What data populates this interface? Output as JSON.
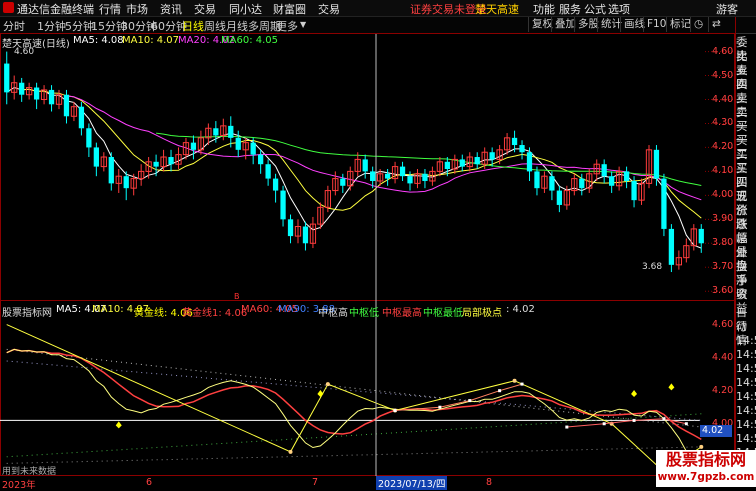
{
  "titlebar": {
    "app_name": "通达信金融终端",
    "menus": [
      "行情",
      "市场",
      "资讯",
      "交易",
      "同小达",
      "财富圈",
      "交易"
    ],
    "login_warning": "证券交易未登录",
    "stock_name": "楚天高速",
    "right_menus": [
      "功能",
      "服务",
      "公式",
      "选项",
      "游客"
    ]
  },
  "toolbar": {
    "periods": [
      "分时",
      "1分钟",
      "5分钟",
      "15分钟",
      "30分钟",
      "60分钟",
      "日线",
      "周线",
      "月线",
      "多周期",
      "更多"
    ],
    "active_period": "日线",
    "right_buttons": [
      "复权",
      "叠加",
      "多股",
      "统计",
      "画线",
      "F10",
      "标记"
    ]
  },
  "upper_legend": {
    "name": "楚天高速(日线)",
    "ma5": "MA5: 4.08",
    "ma10": "MA10: 4.07",
    "ma20": "MA20: 4.02",
    "ma60": "MA60: 4.05"
  },
  "upper_axis": [
    "4.60",
    "4.50",
    "4.40",
    "4.30",
    "4.20",
    "4.10",
    "4.00",
    "3.90",
    "3.80",
    "3.70",
    "3.60"
  ],
  "high_label": "4.60",
  "low_label": "3.68",
  "marker_b": "B",
  "lower_legend": {
    "name": "股票指标网",
    "ma5": "MA5: 4.07",
    "ma10": "MA10: 4.07",
    "gold": "黄金线: 4.06",
    "gold1": "黄金线1: 4.06",
    "ma60": "MA60: 4.05",
    "ma90": "MA90: 3.88",
    "zs_high": "中枢高",
    "zs_low": "中枢低",
    "zs_max": "中枢最高",
    "zs_min": "中枢最低",
    "local": "局部极点",
    "value": ": 4.02"
  },
  "lower_axis": [
    "4.60",
    "4.40",
    "4.20",
    "4.00",
    "3.80"
  ],
  "lower_tag": "4.02",
  "note": "用到未来数据",
  "date_axis": {
    "year": "2023年",
    "months": [
      "6",
      "7",
      "8"
    ],
    "cursor_date": "2023/07/13/四"
  },
  "right_panel_upper": [
    "委比",
    "卖五",
    "卖四",
    "卖三",
    "卖二",
    "卖一",
    "买一",
    "买二",
    "买三",
    "买四",
    "买五",
    "现价",
    "涨跌",
    "涨幅",
    "总量",
    "外盘",
    "换手",
    "净资",
    "收益"
  ],
  "right_panel_lower": [
    "自动",
    "行情",
    "14:5",
    "14:5",
    "14:5",
    "14:5",
    "14:5",
    "14:5",
    "14:5",
    "14:5",
    "14:5",
    "14:5"
  ],
  "watermark": {
    "cn": "股票指标网",
    "url": "www.7gpzb.com"
  },
  "chart_data": {
    "type": "candlestick",
    "ylim": [
      3.58,
      4.64
    ],
    "candles": [
      [
        4.55,
        4.43,
        4.6,
        4.38
      ],
      [
        4.43,
        4.47,
        4.5,
        4.4
      ],
      [
        4.47,
        4.42,
        4.49,
        4.39
      ],
      [
        4.42,
        4.45,
        4.47,
        4.4
      ],
      [
        4.45,
        4.4,
        4.47,
        4.36
      ],
      [
        4.4,
        4.44,
        4.46,
        4.38
      ],
      [
        4.44,
        4.38,
        4.46,
        4.35
      ],
      [
        4.38,
        4.42,
        4.44,
        4.36
      ],
      [
        4.42,
        4.33,
        4.44,
        4.3
      ],
      [
        4.33,
        4.37,
        4.39,
        4.31
      ],
      [
        4.37,
        4.28,
        4.39,
        4.25
      ],
      [
        4.28,
        4.2,
        4.3,
        4.16
      ],
      [
        4.2,
        4.12,
        4.22,
        4.08
      ],
      [
        4.12,
        4.16,
        4.18,
        4.1
      ],
      [
        4.16,
        4.05,
        4.18,
        4.02
      ],
      [
        4.05,
        4.08,
        4.11,
        4.01
      ],
      [
        4.08,
        4.03,
        4.1,
        3.98
      ],
      [
        4.03,
        4.07,
        4.09,
        4.0
      ],
      [
        4.07,
        4.1,
        4.13,
        4.04
      ],
      [
        4.1,
        4.14,
        4.16,
        4.07
      ],
      [
        4.14,
        4.12,
        4.17,
        4.08
      ],
      [
        4.12,
        4.16,
        4.19,
        4.1
      ],
      [
        4.16,
        4.13,
        4.19,
        4.1
      ],
      [
        4.13,
        4.17,
        4.2,
        4.11
      ],
      [
        4.17,
        4.22,
        4.24,
        4.15
      ],
      [
        4.22,
        4.19,
        4.25,
        4.15
      ],
      [
        4.19,
        4.24,
        4.27,
        4.17
      ],
      [
        4.24,
        4.28,
        4.3,
        4.21
      ],
      [
        4.28,
        4.25,
        4.31,
        4.22
      ],
      [
        4.25,
        4.29,
        4.32,
        4.23
      ],
      [
        4.29,
        4.24,
        4.33,
        4.2
      ],
      [
        4.24,
        4.19,
        4.27,
        4.16
      ],
      [
        4.19,
        4.22,
        4.24,
        4.15
      ],
      [
        4.22,
        4.17,
        4.24,
        4.13
      ],
      [
        4.17,
        4.13,
        4.19,
        4.09
      ],
      [
        4.13,
        4.07,
        4.15,
        4.04
      ],
      [
        4.07,
        4.02,
        4.09,
        3.97
      ],
      [
        4.02,
        3.9,
        4.04,
        3.87
      ],
      [
        3.9,
        3.83,
        3.92,
        3.8
      ],
      [
        3.83,
        3.87,
        3.9,
        3.8
      ],
      [
        3.87,
        3.8,
        3.89,
        3.77
      ],
      [
        3.8,
        3.88,
        3.91,
        3.78
      ],
      [
        3.88,
        3.95,
        3.97,
        3.86
      ],
      [
        3.95,
        4.02,
        4.04,
        3.93
      ],
      [
        4.02,
        4.07,
        4.1,
        4.0
      ],
      [
        4.07,
        4.04,
        4.09,
        4.01
      ],
      [
        4.04,
        4.1,
        4.12,
        4.02
      ],
      [
        4.1,
        4.15,
        4.18,
        4.08
      ],
      [
        4.15,
        4.1,
        4.17,
        4.07
      ],
      [
        4.1,
        4.06,
        4.12,
        4.03
      ],
      [
        4.06,
        4.09,
        4.11,
        4.04
      ],
      [
        4.09,
        4.07,
        4.11,
        4.04
      ],
      [
        4.07,
        4.12,
        4.14,
        4.05
      ],
      [
        4.12,
        4.08,
        4.14,
        4.06
      ],
      [
        4.08,
        4.05,
        4.1,
        4.02
      ],
      [
        4.05,
        4.09,
        4.11,
        4.03
      ],
      [
        4.09,
        4.06,
        4.11,
        4.03
      ],
      [
        4.06,
        4.1,
        4.12,
        4.04
      ],
      [
        4.1,
        4.14,
        4.16,
        4.08
      ],
      [
        4.14,
        4.11,
        4.16,
        4.08
      ],
      [
        4.11,
        4.15,
        4.17,
        4.09
      ],
      [
        4.15,
        4.12,
        4.17,
        4.1
      ],
      [
        4.12,
        4.16,
        4.18,
        4.1
      ],
      [
        4.16,
        4.13,
        4.18,
        4.11
      ],
      [
        4.13,
        4.18,
        4.2,
        4.11
      ],
      [
        4.18,
        4.15,
        4.2,
        4.12
      ],
      [
        4.15,
        4.19,
        4.21,
        4.13
      ],
      [
        4.19,
        4.24,
        4.26,
        4.17
      ],
      [
        4.24,
        4.21,
        4.27,
        4.18
      ],
      [
        4.21,
        4.18,
        4.23,
        4.15
      ],
      [
        4.18,
        4.1,
        4.2,
        4.06
      ],
      [
        4.1,
        4.03,
        4.12,
        4.0
      ],
      [
        4.03,
        4.08,
        4.1,
        4.01
      ],
      [
        4.08,
        4.02,
        4.1,
        3.98
      ],
      [
        4.02,
        3.96,
        4.04,
        3.93
      ],
      [
        3.96,
        4.02,
        4.04,
        3.94
      ],
      [
        4.02,
        4.07,
        4.09,
        4.0
      ],
      [
        4.07,
        4.03,
        4.09,
        4.0
      ],
      [
        4.03,
        4.09,
        4.11,
        4.01
      ],
      [
        4.09,
        4.13,
        4.15,
        4.06
      ],
      [
        4.13,
        4.08,
        4.15,
        4.05
      ],
      [
        4.08,
        4.04,
        4.1,
        4.01
      ],
      [
        4.04,
        4.1,
        4.12,
        4.02
      ],
      [
        4.1,
        4.06,
        4.12,
        4.03
      ],
      [
        4.06,
        3.98,
        4.08,
        3.95
      ],
      [
        3.98,
        4.05,
        4.07,
        3.96
      ],
      [
        4.05,
        4.19,
        4.21,
        4.03
      ],
      [
        4.19,
        4.07,
        4.21,
        4.04
      ],
      [
        4.07,
        3.86,
        4.09,
        3.83
      ],
      [
        3.86,
        3.71,
        3.88,
        3.68
      ],
      [
        3.71,
        3.74,
        3.77,
        3.69
      ],
      [
        3.74,
        3.79,
        3.82,
        3.72
      ],
      [
        3.79,
        3.86,
        3.88,
        3.77
      ],
      [
        3.86,
        3.8,
        3.88,
        3.76
      ]
    ]
  }
}
